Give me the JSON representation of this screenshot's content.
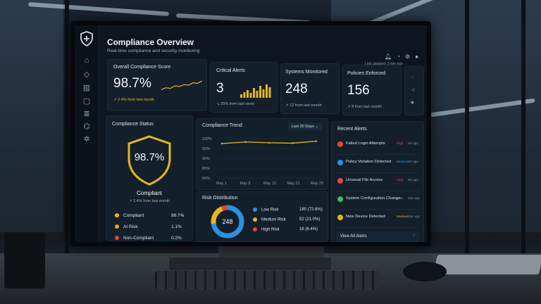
{
  "header": {
    "title": "Compliance Overview",
    "subtitle": "Real-time compliance and security monitoring",
    "last_updated": "Last updated: 2 min ago"
  },
  "sidebar": {
    "items": [
      "home-icon",
      "shield-icon",
      "chart-icon",
      "document-icon",
      "list-icon",
      "settings-icon",
      "gear-icon"
    ]
  },
  "kpis": {
    "compliance_score": {
      "label": "Overall Compliance Score",
      "value": "98.7%",
      "delta": "↗ 2.4% from last month",
      "sparkline": [
        0.2,
        0.35,
        0.3,
        0.5,
        0.45,
        0.6,
        0.55,
        0.75,
        0.7,
        0.9
      ]
    },
    "critical_alerts": {
      "label": "Critical Alerts",
      "value": "3",
      "delta": "↘ 25% from last week",
      "bars": [
        0.25,
        0.4,
        0.55,
        0.35,
        0.7,
        0.5,
        0.85,
        0.6,
        0.95,
        0.75
      ]
    },
    "systems_monitored": {
      "label": "Systems Monitored",
      "value": "248",
      "delta": "↗ 12 from last month"
    },
    "policies_enforced": {
      "label": "Policies Enforced",
      "value": "156",
      "delta": "↗ 8 from last month"
    }
  },
  "compliance_status": {
    "title": "Compliance Status",
    "score": "98.7%",
    "status": "Compliant",
    "delta": "↗ 2.4% from last month",
    "legend": [
      {
        "label": "Compliant",
        "value": "98.7%",
        "color": "#e8b521"
      },
      {
        "label": "At Risk",
        "value": "1.1%",
        "color": "#f0a01f"
      },
      {
        "label": "Non-Compliant",
        "value": "0.2%",
        "color": "#e0483c"
      }
    ]
  },
  "trend": {
    "title": "Compliance Trend",
    "range_select": "Last 30 Days ⌄",
    "y_ticks": [
      "100%",
      "95%",
      "90%",
      "85%",
      "80%"
    ],
    "x_ticks": [
      "May 1",
      "May 8",
      "May 15",
      "May 22",
      "May 29"
    ],
    "line_color": "#e8b521"
  },
  "chart_data": {
    "type": "line",
    "title": "Compliance Trend",
    "x": [
      "May 1",
      "May 8",
      "May 15",
      "May 22",
      "May 29"
    ],
    "series": [
      {
        "values": [
          97.5,
          98.3,
          97.9,
          97.7,
          98.7
        ]
      }
    ],
    "ylim": [
      80,
      100
    ],
    "grid": true
  },
  "risk": {
    "title": "Risk Distribution",
    "center": "248",
    "rows": [
      {
        "label": "Low Risk",
        "value": "180 (72.6%)",
        "color": "#2f8fe0",
        "fraction": 0.726
      },
      {
        "label": "Medium Risk",
        "value": "52 (21.0%)",
        "color": "#e8b521",
        "fraction": 0.21
      },
      {
        "label": "High Risk",
        "value": "16 (6.4%)",
        "color": "#e0483c",
        "fraction": 0.064
      }
    ]
  },
  "alerts": {
    "title": "Recent Alerts",
    "items": [
      {
        "label": "Failed Login Attempts",
        "severity": "High",
        "time": "2m ago",
        "color": "#e0483c"
      },
      {
        "label": "Policy Violation Detected",
        "severity": "Medium",
        "time": "5m ago",
        "color": "#2f8fe0"
      },
      {
        "label": "Unusual File Access",
        "severity": "High",
        "time": "8m ago",
        "color": "#e0483c"
      },
      {
        "label": "System Configuration Change",
        "severity": "Low",
        "time": "15m ago",
        "color": "#3fbf6a"
      },
      {
        "label": "New Device Detected",
        "severity": "Medium",
        "time": "25m ago",
        "color": "#e8b521"
      }
    ],
    "view_all": "View All Alerts",
    "view_all_arrow": "›"
  }
}
